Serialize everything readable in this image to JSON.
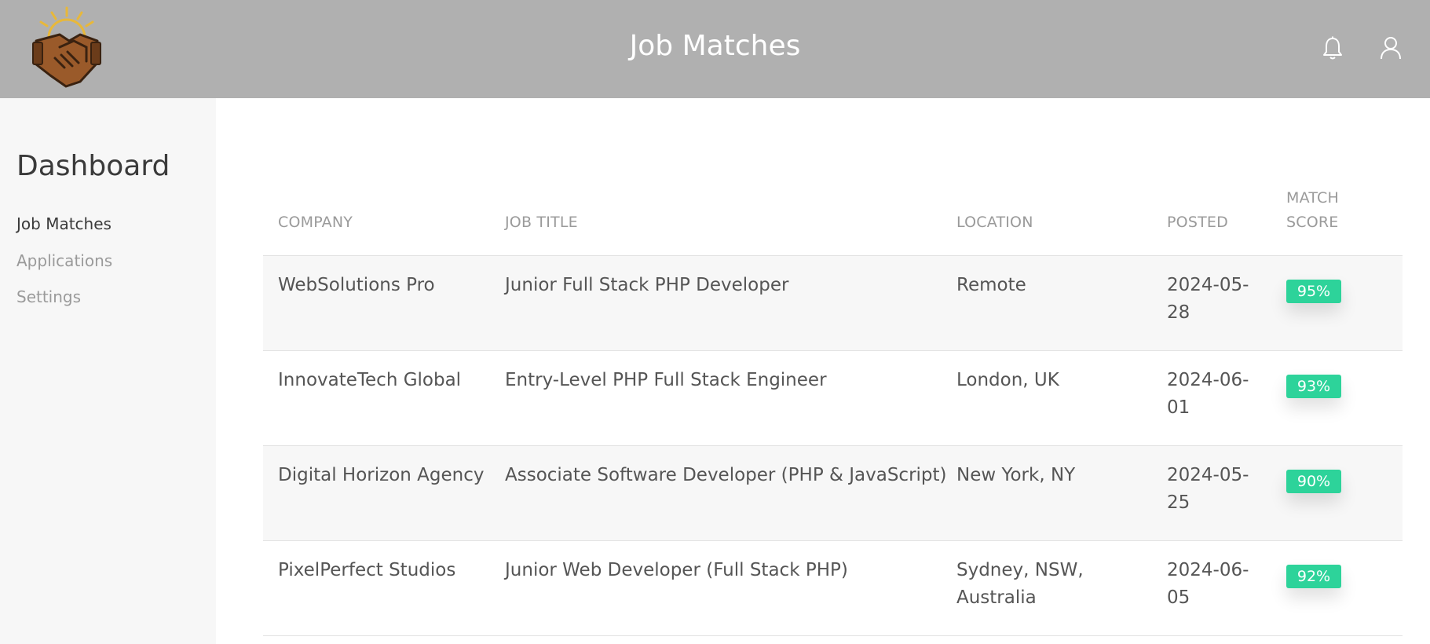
{
  "header": {
    "title": "Job Matches",
    "logo_icon": "handshake-sun-logo",
    "bell_icon": "bell-icon",
    "user_icon": "user-icon"
  },
  "sidebar": {
    "title": "Dashboard",
    "items": [
      {
        "label": "Job Matches",
        "active": true
      },
      {
        "label": "Applications",
        "active": false
      },
      {
        "label": "Settings",
        "active": false
      }
    ]
  },
  "table": {
    "headers": {
      "company": "COMPANY",
      "job_title": "JOB TITLE",
      "location": "LOCATION",
      "posted": "POSTED",
      "match_score": "MATCH SCORE"
    },
    "rows": [
      {
        "company": "WebSolutions Pro",
        "job_title": "Junior Full Stack PHP Developer",
        "location": "Remote",
        "posted": "2024-05-28",
        "score": "95%"
      },
      {
        "company": "InnovateTech Global",
        "job_title": "Entry-Level PHP Full Stack Engineer",
        "location": "London, UK",
        "posted": "2024-06-01",
        "score": "93%"
      },
      {
        "company": "Digital Horizon Agency",
        "job_title": "Associate Software Developer (PHP & JavaScript)",
        "location": "New York, NY",
        "posted": "2024-05-25",
        "score": "90%"
      },
      {
        "company": "PixelPerfect Studios",
        "job_title": "Junior Web Developer (Full Stack PHP)",
        "location": "Sydney, NSW, Australia",
        "posted": "2024-06-05",
        "score": "92%"
      }
    ]
  },
  "colors": {
    "header_bg": "#b0b0b0",
    "sidebar_bg": "#f7f7f7",
    "badge": "#2dd39a",
    "row_alt": "#f7f7f7"
  }
}
